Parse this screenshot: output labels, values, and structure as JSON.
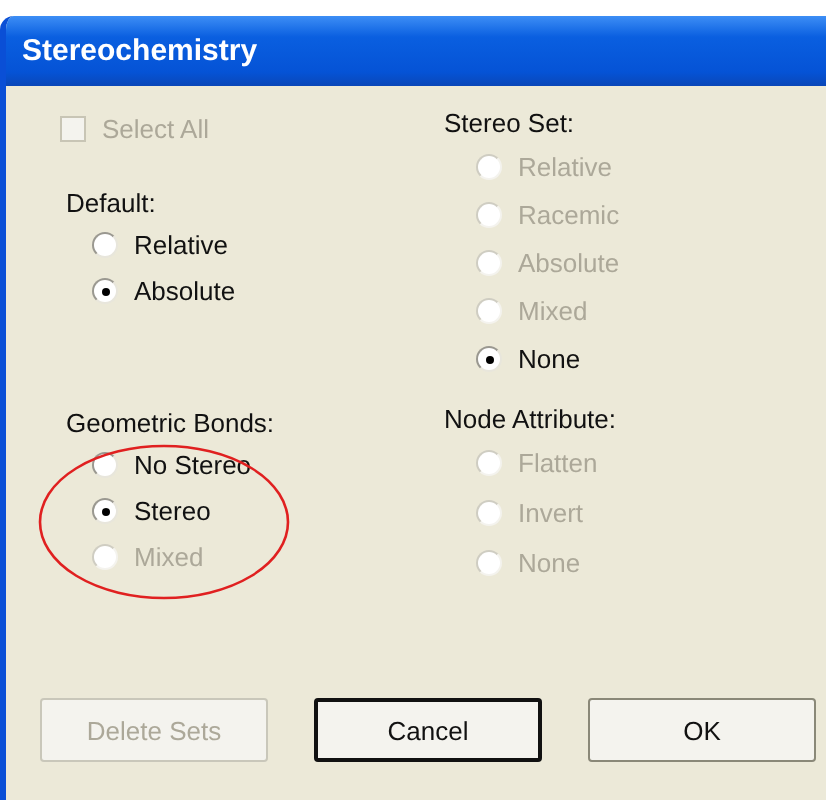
{
  "window": {
    "title": "Stereochemistry"
  },
  "select_all": {
    "label": "Select All",
    "checked": false,
    "disabled": true
  },
  "stereo_set": {
    "label": "Stereo Set:",
    "options": [
      {
        "label": "Relative",
        "selected": false,
        "disabled": true
      },
      {
        "label": "Racemic",
        "selected": false,
        "disabled": true
      },
      {
        "label": "Absolute",
        "selected": false,
        "disabled": true
      },
      {
        "label": "Mixed",
        "selected": false,
        "disabled": true
      },
      {
        "label": "None",
        "selected": true,
        "disabled": false
      }
    ]
  },
  "default": {
    "label": "Default:",
    "options": [
      {
        "label": "Relative",
        "selected": false,
        "disabled": false
      },
      {
        "label": "Absolute",
        "selected": true,
        "disabled": false
      }
    ]
  },
  "geometric_bonds": {
    "label": "Geometric Bonds:",
    "options": [
      {
        "label": "No Stereo",
        "selected": false,
        "disabled": false
      },
      {
        "label": "Stereo",
        "selected": true,
        "disabled": false
      },
      {
        "label": "Mixed",
        "selected": false,
        "disabled": true
      }
    ]
  },
  "node_attribute": {
    "label": "Node Attribute:",
    "options": [
      {
        "label": "Flatten",
        "selected": false,
        "disabled": true
      },
      {
        "label": "Invert",
        "selected": false,
        "disabled": true
      },
      {
        "label": "None",
        "selected": false,
        "disabled": true
      }
    ]
  },
  "buttons": [
    {
      "label": "Delete Sets",
      "disabled": true,
      "focused": false
    },
    {
      "label": "Cancel",
      "disabled": false,
      "focused": true
    },
    {
      "label": "OK",
      "disabled": false,
      "focused": false
    }
  ]
}
